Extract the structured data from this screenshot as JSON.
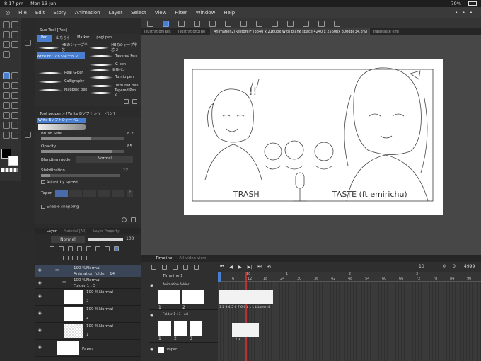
{
  "status": {
    "time": "8:17 pm",
    "date": "Mon 13 Jun",
    "battery": "79%"
  },
  "menu": [
    "File",
    "Edit",
    "Story",
    "Animation",
    "Layer",
    "Select",
    "View",
    "Filter",
    "Window",
    "Help"
  ],
  "tabs": [
    "Illustration[Res",
    "Illustration3[Re",
    "Animation2[Restore]* (3840 x 2160px With blank space:4240 x 2560px 300dpi 34.8%)",
    "Trashtaste emi"
  ],
  "subtool": {
    "title": "Sub Tool [Pen]",
    "groups": [
      "Pen",
      "山ならう",
      "Marker",
      "pogi pen"
    ],
    "brushes_left": [
      "HBのシャープ半芯",
      "Write Bソフトシャーペン",
      "Real G-pen",
      "Calligraphy",
      "Mapping pen"
    ],
    "brushes_right": [
      "HBのシャープ半芯 2",
      "Tapered Pen",
      "G-pen",
      "Turnip pen",
      "Textured pen",
      "Tapered Pen 2"
    ],
    "brushes_right_extra": "鉄筆ペン"
  },
  "toolprop": {
    "title": "Tool property [Write Bソフトシャーペン]",
    "preview_label": "Write Bソフトシャーペン",
    "brush_size_label": "Brush Size",
    "brush_size": "8.2",
    "opacity_label": "Opacity",
    "opacity": "85",
    "blending_label": "Blending mode",
    "blending": "Normal",
    "stabilization_label": "Stabilization",
    "stabilization": "12",
    "adjust_speed": "Adjust by speed",
    "taper_label": "Taper",
    "enable_snapping": "Enable snapping"
  },
  "layer": {
    "tabs": [
      "Layer",
      "Material [All]",
      "Layer Property"
    ],
    "blend": "Normal",
    "opacity": "100",
    "rows": [
      {
        "pct": "100 %",
        "mode": "Normal",
        "name": "Animation folder : 14"
      },
      {
        "pct": "100 %",
        "mode": "Normal",
        "name": "Folder 1 : 3"
      },
      {
        "pct": "100 %",
        "mode": "Normal",
        "name": "3"
      },
      {
        "pct": "100 %",
        "mode": "Normal",
        "name": "2"
      },
      {
        "pct": "100 %",
        "mode": "Normal",
        "name": "1"
      },
      {
        "pct": "",
        "mode": "",
        "name": "Paper"
      }
    ]
  },
  "canvas": {
    "left_text": "TRASH",
    "right_text": "TASTE (ft emirichu)",
    "marks": "!!"
  },
  "timeline": {
    "tab": "Timeline",
    "tab2": "All video view",
    "name": "Timeline 1",
    "frame_current": "10",
    "frame_sep": "0",
    "frame_zero": "0",
    "frame_end": "4999",
    "scale_top": [
      "0",
      "10",
      "1",
      "2",
      "3"
    ],
    "scale": [
      "6",
      "12",
      "18",
      "24",
      "30",
      "36",
      "42",
      "48",
      "54",
      "60",
      "66",
      "72",
      "78",
      "84",
      "90"
    ],
    "tracks": [
      {
        "name": "Animation folder",
        "cel_label": "1 2 3 4 5 6 7 6 6 L L L L Layer 4",
        "nums": [
          "1",
          "2"
        ]
      },
      {
        "name": "Folder 1 : 3 : cel",
        "cel_label": "1 2 3",
        "nums": [
          "1",
          "2",
          "3"
        ]
      },
      {
        "name": "Paper",
        "cel_label": "",
        "nums": []
      }
    ]
  },
  "colors": {
    "accent": "#4a7fd0",
    "playhead": "#d03030",
    "panel": "#2e2e2e"
  }
}
